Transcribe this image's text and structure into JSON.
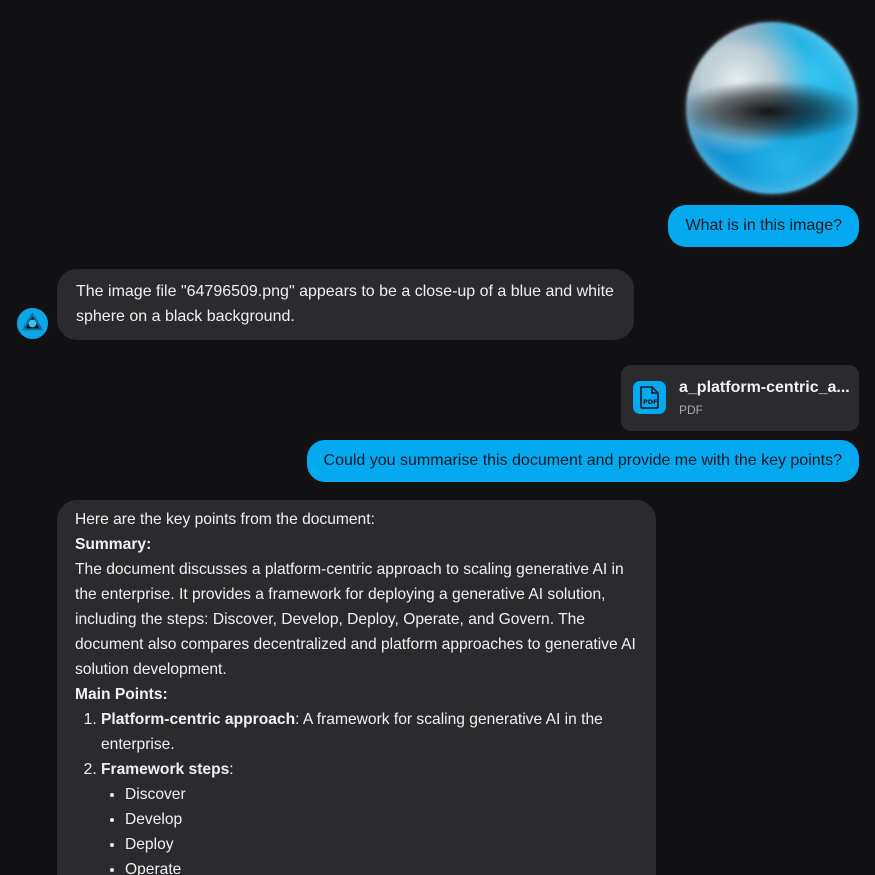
{
  "messages": {
    "user_image": {
      "alt": "blurred blue and white sphere image"
    },
    "user_q1": "What is in this image?",
    "ai_a1": "The image file \"64796509.png\" appears to be a close-up of a blue and white sphere on a black background.",
    "attachment": {
      "name": "a_platform-centric_a...",
      "type": "PDF",
      "icon": "pdf-file-icon"
    },
    "user_q2": "Could you summarise this document and provide me with the key points?",
    "ai_a2": {
      "intro": "Here are the key points from the document:",
      "summary_heading": "Summary:",
      "summary_text": "The document discusses a platform-centric approach to scaling generative AI in the enterprise. It provides a framework for deploying a generative AI solution, including the steps: Discover, Develop, Deploy, Operate, and Govern. The document also compares decentralized and platform approaches to generative AI solution development.",
      "main_points_heading": "Main Points:",
      "points": [
        {
          "title": "Platform-centric approach",
          "text": ": A framework for scaling generative AI in the enterprise."
        },
        {
          "title": "Framework steps",
          "text": ":"
        }
      ],
      "steps": [
        "Discover",
        "Develop",
        "Deploy",
        "Operate"
      ]
    }
  },
  "colors": {
    "background": "#111113",
    "user_bubble": "#05a9ef",
    "ai_bubble": "#2b2b2e",
    "accent": "#05a9ef"
  },
  "assistant_avatar_icon": "assistant-logo-icon"
}
